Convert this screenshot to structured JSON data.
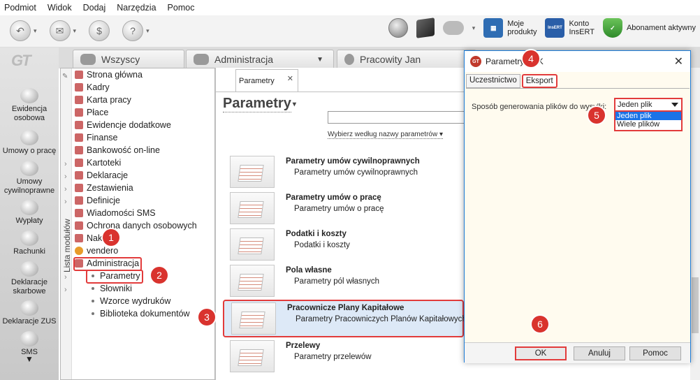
{
  "menu": [
    "Podmiot",
    "Widok",
    "Dodaj",
    "Narzędzia",
    "Pomoc"
  ],
  "toolbar": {
    "moje_produkty": "Moje\nprodukty",
    "konto": "Konto\nInsERT",
    "abonament": "Abonament aktywny",
    "insert_badge": "InsERT"
  },
  "leftnav": {
    "logo": "GT",
    "items": [
      "Ewidencja osobowa",
      "Umowy o pracę",
      "Umowy cywilnoprawne",
      "Wypłaty",
      "Rachunki",
      "Deklaracje skarbowe",
      "Deklaracje ZUS",
      "SMS"
    ]
  },
  "tabs": [
    "Wszyscy",
    "Administracja",
    "Pracowity Jan"
  ],
  "modules": {
    "strip_label": "Lista modułów",
    "items": [
      "Strona główna",
      "Kadry",
      "Karta pracy",
      "Płace",
      "Ewidencje dodatkowe",
      "Finanse",
      "Bankowość on-line",
      "Kartoteki",
      "Deklaracje",
      "Zestawienia",
      "Definicje",
      "Wiadomości SMS",
      "Ochrona danych osobowych",
      "Nakle",
      "vendero",
      "Administracja"
    ],
    "sub": [
      "Parametry",
      "Słowniki",
      "Wzorce wydruków",
      "Biblioteka dokumentów"
    ]
  },
  "content": {
    "tab_label": "Parametry",
    "title": "Parametry",
    "filter_link": "Wybierz według nazwy parametrów",
    "rows": [
      {
        "title": "Parametry umów cywilnoprawnych",
        "sub": "Parametry umów cywilnoprawnych"
      },
      {
        "title": "Parametry umów o pracę",
        "sub": "Parametry umów o pracę"
      },
      {
        "title": "Podatki i koszty",
        "sub": "Podatki i koszty"
      },
      {
        "title": "Pola własne",
        "sub": "Parametry pól własnych"
      },
      {
        "title": "Pracownicze Plany Kapitałowe",
        "sub": "Parametry Pracowniczych Planów Kapitałowych"
      },
      {
        "title": "Przelewy",
        "sub": "Parametry przelewów"
      }
    ]
  },
  "dialog": {
    "title": "Parametry PPK",
    "tabs": [
      "Uczestnictwo",
      "Eksport"
    ],
    "label": "Sposób generowania plików do wysyłki:",
    "selected": "Jeden plik",
    "options": [
      "Jeden plik",
      "Wiele plików"
    ],
    "ok": "OK",
    "cancel": "Anuluj",
    "help": "Pomoc"
  },
  "markers": [
    "1",
    "2",
    "3",
    "4",
    "5",
    "6"
  ],
  "colors": {
    "accent_red": "#e23b3b",
    "marker": "#d9332e",
    "selection": "#dde9f7",
    "dialog_bg": "#fffbef"
  }
}
